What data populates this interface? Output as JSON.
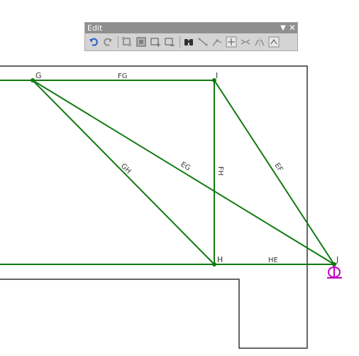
{
  "toolbar": {
    "title": "Edit",
    "buttons": [
      {
        "icon": "undo-icon"
      },
      {
        "icon": "redo-icon"
      },
      {
        "icon": "select-nodes-icon"
      },
      {
        "icon": "select-all-icon"
      },
      {
        "icon": "add-node-icon"
      },
      {
        "icon": "remove-node-icon"
      },
      {
        "icon": "find-icon"
      },
      {
        "icon": "draw-member-icon"
      },
      {
        "icon": "connect-members-icon"
      },
      {
        "icon": "move-icon"
      },
      {
        "icon": "split-member-icon"
      },
      {
        "icon": "mirror-icon"
      },
      {
        "icon": "properties-icon"
      }
    ]
  },
  "truss": {
    "line_color": "#107a10",
    "support_color": "#c000c0",
    "nodes": {
      "G": {
        "label": "G"
      },
      "I": {
        "label": "I"
      },
      "H": {
        "label": "H"
      },
      "J": {
        "label": "J"
      }
    },
    "members": {
      "FG": "FG",
      "GH": "GH",
      "EG": "EG",
      "FH": "FH",
      "EF": "EF",
      "HE": "HE"
    }
  }
}
